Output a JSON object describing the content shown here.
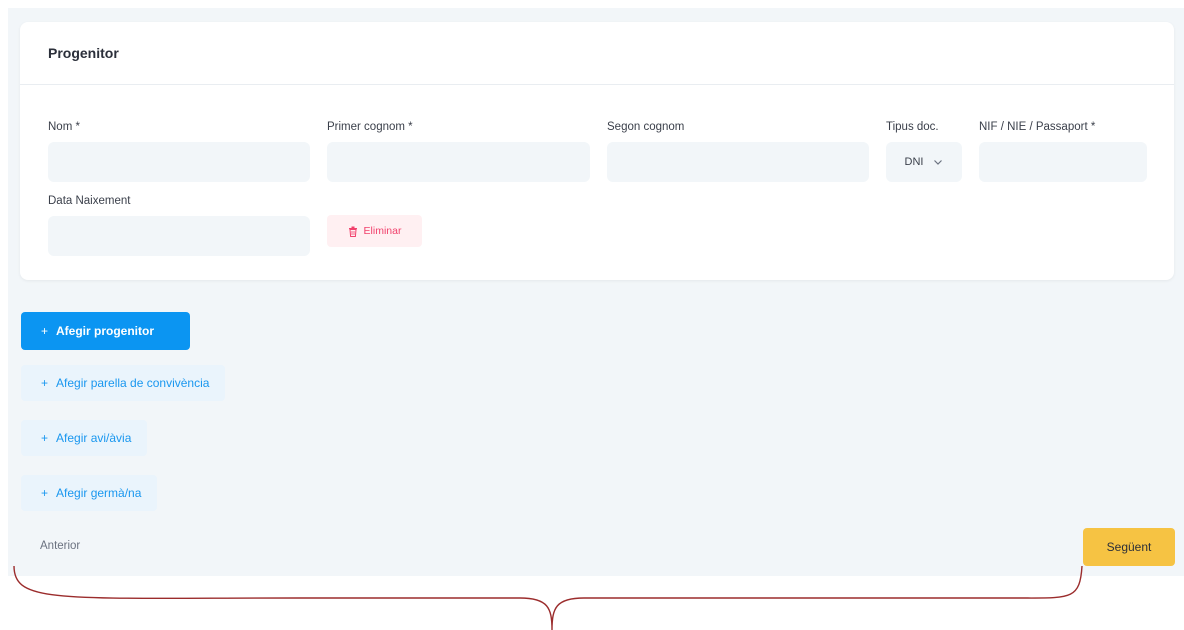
{
  "card": {
    "title": "Progenitor",
    "fields": {
      "nom_label": "Nom *",
      "primer_cognom_label": "Primer cognom *",
      "segon_cognom_label": "Segon cognom",
      "tipus_doc_label": "Tipus doc.",
      "tipus_doc_value": "DNI",
      "nif_label": "NIF / NIE / Passaport *",
      "data_naixement_label": "Data Naixement"
    },
    "delete_label": "Eliminar"
  },
  "actions": {
    "add_progenitor": "Afegir progenitor",
    "add_parella": "Afegir parella de convivència",
    "add_avi": "Afegir avi/àvia",
    "add_germa": "Afegir germà/na",
    "plus": "+"
  },
  "nav": {
    "prev": "Anterior",
    "next": "Següent"
  },
  "colors": {
    "primary": "#0b95f2",
    "light_primary_bg": "#eaf4fc",
    "danger": "#f1416c",
    "warning": "#f6c343",
    "annotation": "#9b2c2c"
  },
  "icons": {
    "delete": "trash-icon",
    "dropdown": "chevron-down-icon",
    "add": "plus-icon"
  }
}
